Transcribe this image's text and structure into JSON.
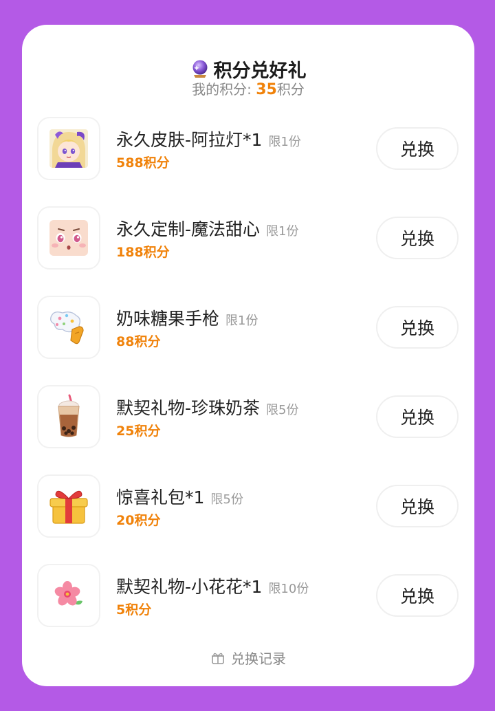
{
  "header": {
    "title": "积分兑好礼",
    "title_icon": "crystal-ball-icon",
    "points_label": "我的积分: ",
    "points_value": "35",
    "points_unit": "积分"
  },
  "items": [
    {
      "name": "永久皮肤-阿拉灯*1",
      "limit": "限1份",
      "price": "588积分",
      "button": "兑换",
      "icon": "anime-girl-avatar-icon"
    },
    {
      "name": "永久定制-魔法甜心",
      "limit": "限1份",
      "price": "188积分",
      "button": "兑换",
      "icon": "cute-face-icon"
    },
    {
      "name": "奶味糖果手枪",
      "limit": "限1份",
      "price": "88积分",
      "button": "兑换",
      "icon": "candy-gun-icon"
    },
    {
      "name": "默契礼物-珍珠奶茶",
      "limit": "限5份",
      "price": "25积分",
      "button": "兑换",
      "icon": "bubble-tea-icon"
    },
    {
      "name": "惊喜礼包*1",
      "limit": "限5份",
      "price": "20积分",
      "button": "兑换",
      "icon": "gift-box-icon"
    },
    {
      "name": "默契礼物-小花花*1",
      "limit": "限10份",
      "price": "5积分",
      "button": "兑换",
      "icon": "flower-icon"
    }
  ],
  "footer": {
    "label": "兑换记录",
    "icon": "gift-record-icon"
  },
  "colors": {
    "background": "#b45ae6",
    "accent": "#f0820a",
    "card": "#ffffff"
  }
}
